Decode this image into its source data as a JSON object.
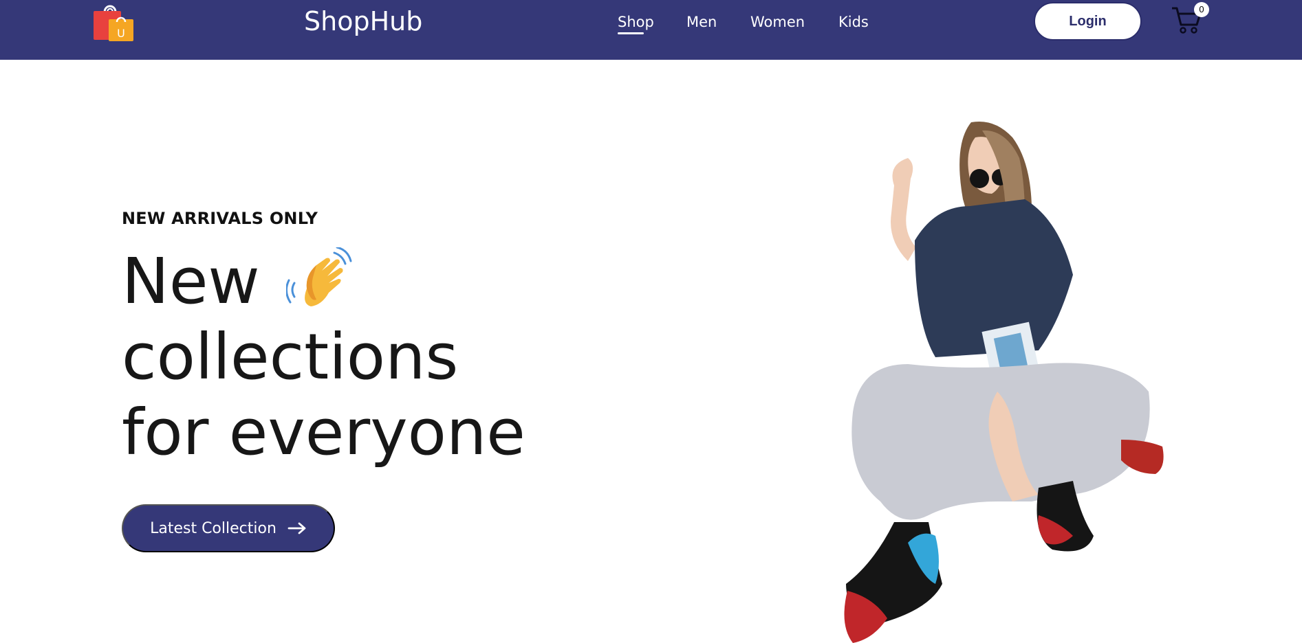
{
  "header": {
    "brand": "ShopHub",
    "logo_letter": "U",
    "nav": [
      {
        "label": "Shop",
        "active": true
      },
      {
        "label": "Men",
        "active": false
      },
      {
        "label": "Women",
        "active": false
      },
      {
        "label": "Kids",
        "active": false
      }
    ],
    "login_label": "Login",
    "cart_count": "0",
    "background_color": "#353878"
  },
  "hero": {
    "eyebrow": "NEW ARRIVALS ONLY",
    "headline_line1": "New",
    "headline_line2": "collections",
    "headline_line3": "for everyone",
    "cta_label": "Latest Collection",
    "cta_icon": "arrow-right-icon",
    "wave_icon": "waving-hand-icon",
    "image": "hero-model-image"
  }
}
